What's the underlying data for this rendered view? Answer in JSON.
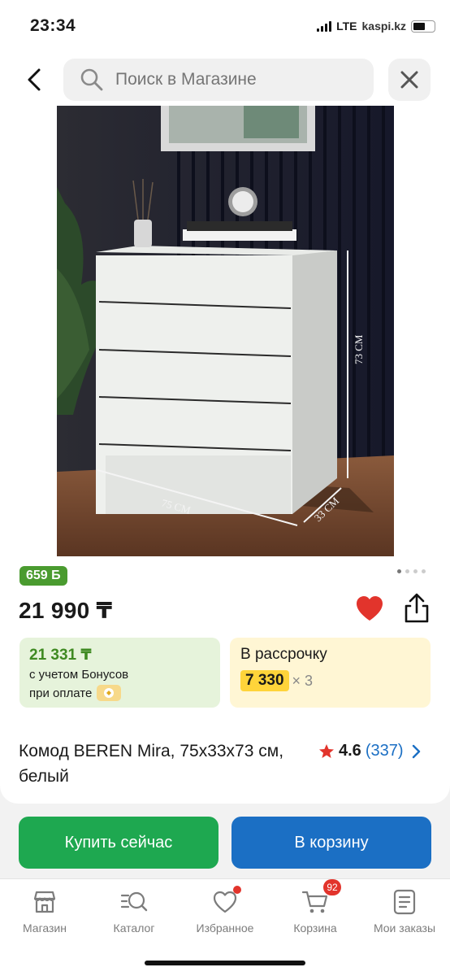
{
  "status_bar": {
    "time": "23:34",
    "network": "LTE",
    "carrier": "kaspi.kz"
  },
  "header": {
    "search_placeholder": "Поиск в Магазине"
  },
  "product": {
    "bonus_badge": "659 Б",
    "price": "21 990 ₸",
    "bonus_offer": {
      "price": "21 331 ₸",
      "line1": "с учетом Бонусов",
      "line2": "при оплате"
    },
    "installment": {
      "title": "В рассрочку",
      "amount": "7 330",
      "times": "× 3"
    },
    "title": "Комод BEREN Mira, 75х33х73 см, белый",
    "rating": "4.6",
    "review_count": "(337)",
    "photo": {
      "dimension_height": "73 СМ",
      "dimension_width": "75 СМ",
      "dimension_depth": "33 СМ",
      "slides_total": 4,
      "slide_active": 1
    }
  },
  "actions": {
    "buy_now": "Купить сейчас",
    "add_to_cart": "В корзину"
  },
  "bottom_nav": {
    "items": [
      {
        "label": "Магазин",
        "icon": "shop-icon"
      },
      {
        "label": "Каталог",
        "icon": "catalog-search-icon"
      },
      {
        "label": "Избранное",
        "icon": "heart-icon"
      },
      {
        "label": "Корзина",
        "icon": "cart-icon",
        "badge": "92"
      },
      {
        "label": "Мои заказы",
        "icon": "orders-icon"
      }
    ]
  },
  "colors": {
    "green_button": "#1ea850",
    "blue_button": "#1b6fc4",
    "favorite_red": "#e2342c",
    "bonus_green": "#4a9b2f",
    "installment_yellow": "#ffd43a"
  }
}
